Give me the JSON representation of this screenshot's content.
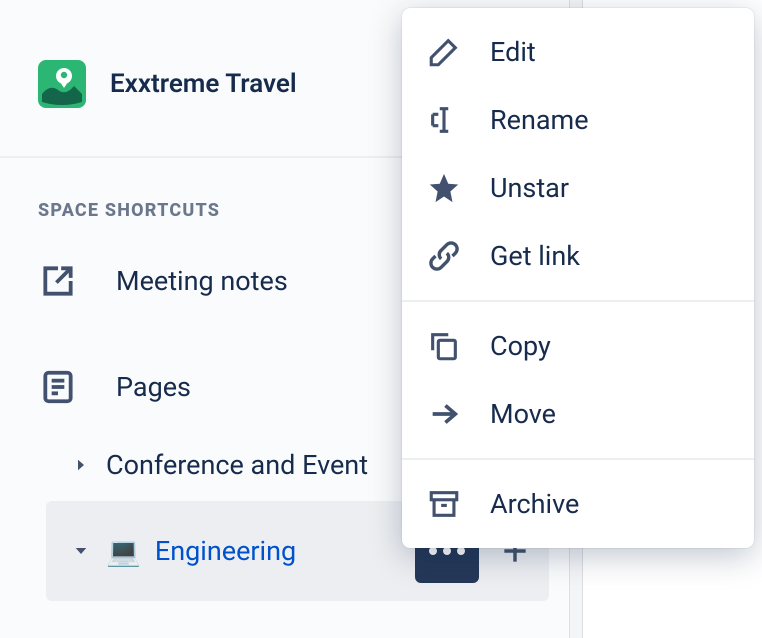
{
  "space": {
    "title": "Exxtreme Travel"
  },
  "section_label": "SPACE SHORTCUTS",
  "shortcuts": [
    {
      "label": "Meeting notes"
    }
  ],
  "pages": {
    "label": "Pages",
    "children": [
      {
        "label": "Conference and Event",
        "icon": "",
        "selected": false
      },
      {
        "label": "Engineering",
        "icon": "💻",
        "selected": true
      }
    ]
  },
  "context_menu": {
    "groups": [
      [
        {
          "icon": "edit",
          "label": "Edit"
        },
        {
          "icon": "rename",
          "label": "Rename"
        },
        {
          "icon": "star",
          "label": "Unstar"
        },
        {
          "icon": "link",
          "label": "Get link"
        }
      ],
      [
        {
          "icon": "copy",
          "label": "Copy"
        },
        {
          "icon": "move",
          "label": "Move"
        }
      ],
      [
        {
          "icon": "archive",
          "label": "Archive"
        }
      ]
    ]
  }
}
